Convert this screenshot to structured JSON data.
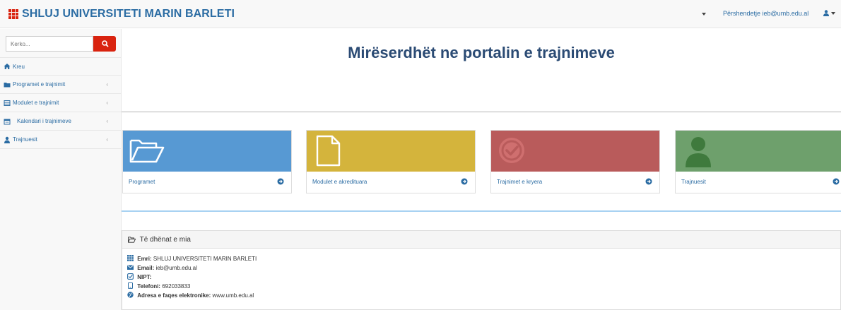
{
  "app": {
    "brand": "SHLUJ UNIVERSITETI MARIN BARLETI",
    "brand_color": "#d9230f",
    "greeting": "Përshendetje ieb@umb.edu.al"
  },
  "sidebar": {
    "search_placeholder": "Kerko...",
    "items": [
      {
        "label": "Kreu",
        "icon": "home-icon"
      },
      {
        "label": "Programet e trajnimit",
        "icon": "folder-icon"
      },
      {
        "label": "Modulet e trajnimit",
        "icon": "table-icon"
      },
      {
        "label": "Kalendari i trajnimeve",
        "icon": "calendar-icon"
      },
      {
        "label": "Trajnuesit",
        "icon": "user-icon"
      }
    ]
  },
  "main": {
    "title": "Mirëserdhët ne portalin e trajnimeve",
    "cards": [
      {
        "label": "Programet",
        "color": "#5799d3",
        "icon": "folder-open-icon"
      },
      {
        "label": "Modulet e akredituara",
        "color": "#d4b43c",
        "icon": "file-icon"
      },
      {
        "label": "Trajnimet e kryera",
        "color": "#b95b5b",
        "icon": "check-circle-icon"
      },
      {
        "label": "Trajnuesit",
        "color": "#6ea06c",
        "icon": "user-icon"
      }
    ]
  },
  "panel": {
    "title": "Të dhënat e mia",
    "rows": [
      {
        "label": "Emri:",
        "value": "SHLUJ UNIVERSITETI MARIN BARLETI",
        "icon": "grid-icon"
      },
      {
        "label": "Email:",
        "value": "ieb@umb.edu.al",
        "icon": "envelope-icon"
      },
      {
        "label": "NIPT:",
        "value": "",
        "icon": "check-square-icon"
      },
      {
        "label": "Telefoni:",
        "value": "692033833",
        "icon": "phone-icon"
      },
      {
        "label": "Adresa e faqes elektronike:",
        "value": "www.umb.edu.al",
        "icon": "globe-icon"
      }
    ]
  }
}
